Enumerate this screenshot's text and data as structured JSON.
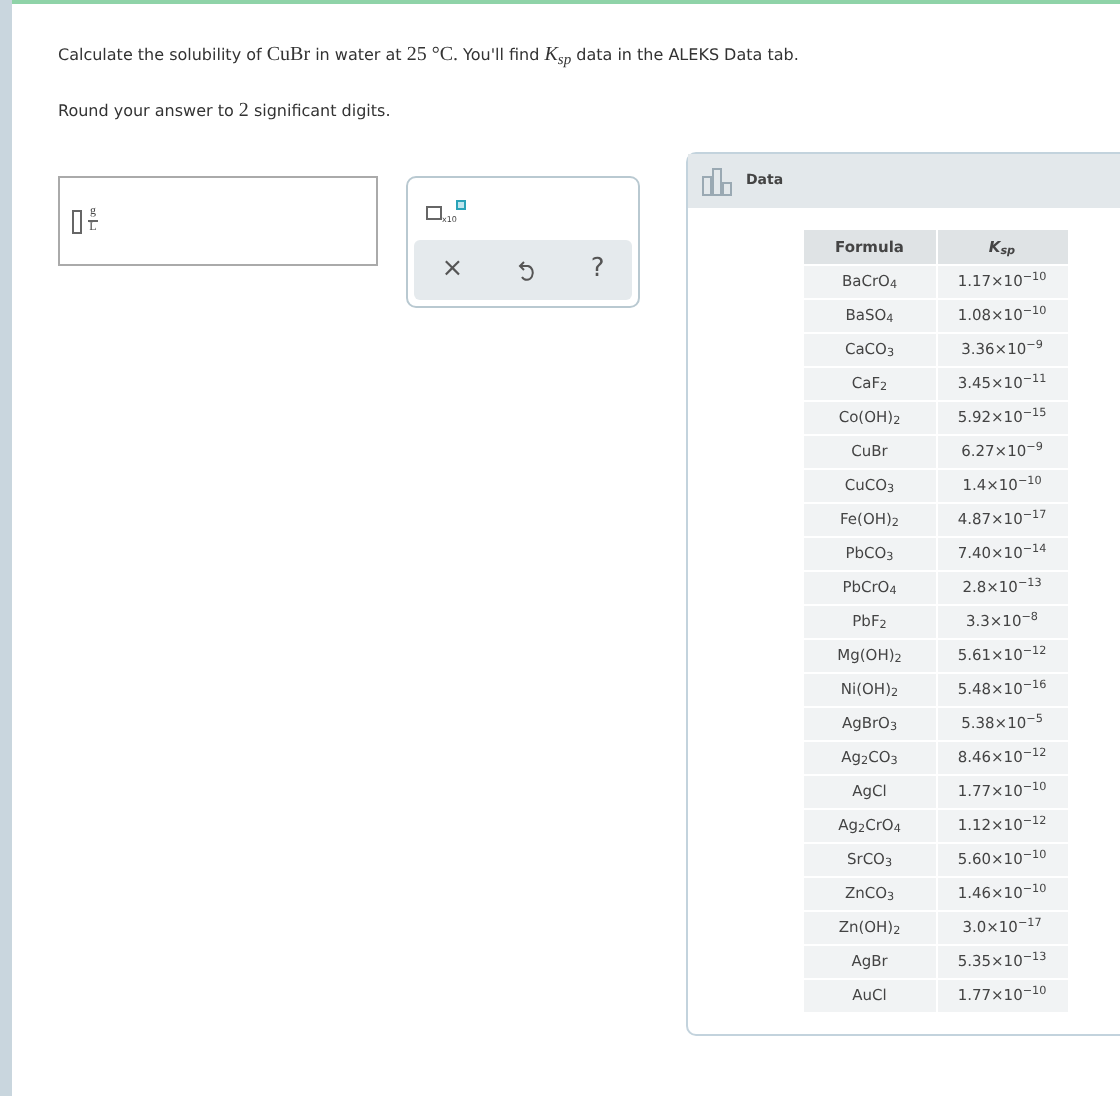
{
  "question": [
    {
      "kind": "text",
      "text": "Calculate the solubility of "
    },
    {
      "kind": "math",
      "text": "CuBr"
    },
    {
      "kind": "text",
      "text": " in water at "
    },
    {
      "kind": "math",
      "text": "25 °C."
    },
    {
      "kind": "text",
      "text": " You'll find "
    },
    {
      "kind": "variable",
      "text": "K$_{sp}$"
    },
    {
      "kind": "text",
      "text": " data in the ALEKS Data tab."
    }
  ],
  "instruction": [
    {
      "kind": "text",
      "text": "Round your answer to "
    },
    {
      "kind": "math",
      "text": "2"
    },
    {
      "kind": "text",
      "text": " significant digits."
    }
  ],
  "answer": {
    "unit_numerator": "g",
    "unit_denominator": "L"
  },
  "tools": {
    "template_label": "x10",
    "buttons": [
      {
        "kind": "clear",
        "label": "×"
      },
      {
        "kind": "undo"
      },
      {
        "kind": "help",
        "label": "?"
      }
    ]
  },
  "data_panel": {
    "title": "Data",
    "columns": [
      {
        "kind": "text",
        "label": "Formula"
      },
      {
        "kind": "variable",
        "label": "K$_{sp}$"
      }
    ],
    "rows": [
      [
        "BaCrO$_{4}$",
        "1.17×10$^{−10}$"
      ],
      [
        "BaSO$_{4}$",
        "1.08×10$^{−10}$"
      ],
      [
        "CaCO$_{3}$",
        "3.36×10$^{−9}$"
      ],
      [
        "CaF$_{2}$",
        "3.45×10$^{−11}$"
      ],
      [
        "Co(OH)$_{2}$",
        "5.92×10$^{−15}$"
      ],
      [
        "CuBr",
        "6.27×10$^{−9}$"
      ],
      [
        "CuCO$_{3}$",
        "1.4×10$^{−10}$"
      ],
      [
        "Fe(OH)$_{2}$",
        "4.87×10$^{−17}$"
      ],
      [
        "PbCO$_{3}$",
        "7.40×10$^{−14}$"
      ],
      [
        "PbCrO$_{4}$",
        "2.8×10$^{−13}$"
      ],
      [
        "PbF$_{2}$",
        "3.3×10$^{−8}$"
      ],
      [
        "Mg(OH)$_{2}$",
        "5.61×10$^{−12}$"
      ],
      [
        "Ni(OH)$_{2}$",
        "5.48×10$^{−16}$"
      ],
      [
        "AgBrO$_{3}$",
        "5.38×10$^{−5}$"
      ],
      [
        "Ag$_{2}$CO$_{3}$",
        "8.46×10$^{−12}$"
      ],
      [
        "AgCl",
        "1.77×10$^{−10}$"
      ],
      [
        "Ag$_{2}$CrO$_{4}$",
        "1.12×10$^{−12}$"
      ],
      [
        "SrCO$_{3}$",
        "5.60×10$^{−10}$"
      ],
      [
        "ZnCO$_{3}$",
        "1.46×10$^{−10}$"
      ],
      [
        "Zn(OH)$_{2}$",
        "3.0×10$^{−17}$"
      ],
      [
        "AgBr",
        "5.35×10$^{−13}$"
      ],
      [
        "AuCl",
        "1.77×10$^{−10}$"
      ]
    ]
  }
}
